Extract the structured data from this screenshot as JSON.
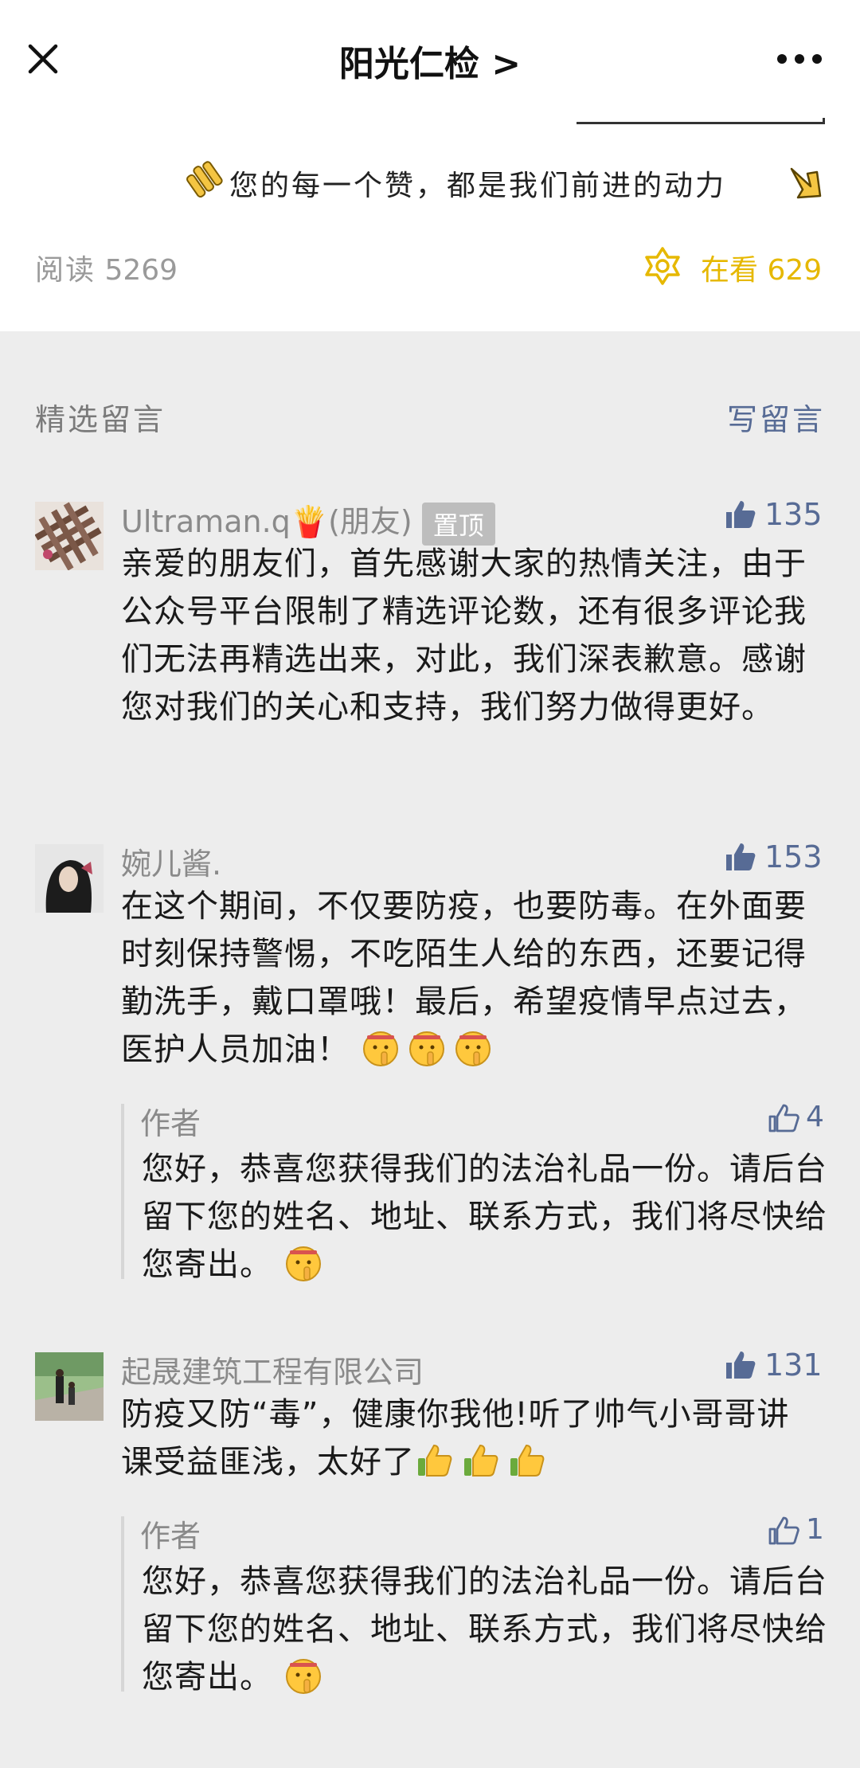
{
  "header": {
    "title": "阳光仁检 >"
  },
  "article_footer": {
    "slogan": "您的每一个赞，都是我们前进的动力",
    "read_label": "阅读",
    "read_count": "5269",
    "wow_label": "在看",
    "wow_count": "629"
  },
  "comments_section": {
    "title": "精选留言",
    "write_label": "写留言"
  },
  "comments": [
    {
      "name": "Ultraman.q🍟(朋友)",
      "pinned_label": "置顶",
      "likes": "135",
      "text": "亲爱的朋友们，首先感谢大家的热情关注，由于公众号平台限制了精选评论数，还有很多评论我们无法再精选出来，对此，我们深表歉意。感谢您对我们的关心和支持，我们努力做得更好。"
    },
    {
      "name": "婉儿酱.",
      "likes": "153",
      "text": "在这个期间，不仅要防疫，也要防毒。在外面要时刻保持警惕，不吃陌生人给的东西，还要记得勤洗手，戴口罩哦！最后，希望疫情早点过去，医护人员加油！",
      "reply": {
        "author": "作者",
        "likes": "4",
        "text": "您好，恭喜您获得我们的法治礼品一份。请后台留下您的姓名、地址、联系方式，我们将尽快给您寄出。"
      }
    },
    {
      "name": "起晟建筑工程有限公司",
      "likes": "131",
      "text": "防疫又防“毒”，健康你我他!听了帅气小哥哥讲课受益匪浅，太好了",
      "reply": {
        "author": "作者",
        "likes": "1",
        "text": "您好，恭喜您获得我们的法治礼品一份。请后台留下您的姓名、地址、联系方式，我们将尽快给您寄出。"
      }
    }
  ],
  "icons": {
    "close": "close-icon",
    "more": "more-dots-icon",
    "like_filled": "thumbs-up-filled-icon",
    "like_outline": "thumbs-up-outline-icon",
    "wow": "wow-flower-icon",
    "clap": "clap-emoji-icon",
    "point": "point-down-emoji-icon",
    "shush": "shush-emoji-icon",
    "thumbs": "thumbs-up-emoji-icon"
  },
  "colors": {
    "link": "#576B95",
    "wow": "#E6B800",
    "background": "#EDEDED",
    "muted": "#8a8a8a"
  }
}
